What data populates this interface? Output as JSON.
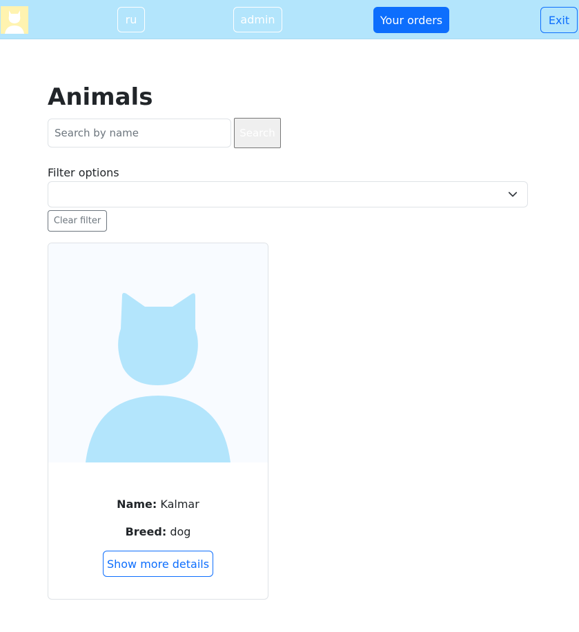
{
  "navbar": {
    "lang_label": "ru",
    "user_label": "admin",
    "orders_label": "Your orders",
    "exit_label": "Exit",
    "logo_icon": "cat-avatar-icon",
    "background": "#b3e5fc",
    "primary_color": "#0d6efd"
  },
  "main": {
    "title": "Animals",
    "search": {
      "placeholder": "Search by name",
      "value": "",
      "button_label": "Search"
    },
    "filter": {
      "label": "Filter options",
      "selected": "",
      "clear_label": "Clear filter"
    },
    "animals": [
      {
        "name_label": "Name:",
        "name": "Kalmar",
        "breed_label": "Breed:",
        "breed": "dog",
        "details_label": "Show more details",
        "image_icon": "cat-placeholder-icon"
      }
    ]
  }
}
